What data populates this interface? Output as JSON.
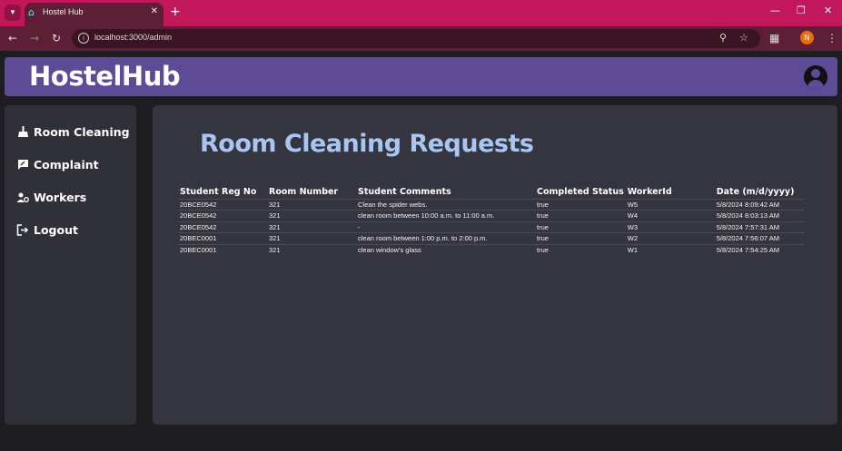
{
  "browser": {
    "tab_title": "Hostel Hub",
    "url": "localhost:3000/admin",
    "profile_initial": "N"
  },
  "header": {
    "brand": "HostelHub"
  },
  "sidebar": {
    "items": [
      {
        "label": "Room Cleaning",
        "icon": "broom-icon"
      },
      {
        "label": "Complaint",
        "icon": "complaint-icon"
      },
      {
        "label": "Workers",
        "icon": "workers-icon"
      },
      {
        "label": "Logout",
        "icon": "logout-icon"
      }
    ]
  },
  "main": {
    "title": "Room Cleaning Requests",
    "table": {
      "columns": [
        "Student Reg No",
        "Room Number",
        "Student Comments",
        "Completed Status",
        "WorkerId",
        "Date (m/d/yyyy)"
      ],
      "rows": [
        [
          "20BCE0542",
          "321",
          "Clean the spider webs.",
          "true",
          "W5",
          "5/8/2024 8:09:42 AM"
        ],
        [
          "20BCE0542",
          "321",
          "clean room between 10:00 a.m. to 11:00 a.m.",
          "true",
          "W4",
          "5/8/2024 8:03:13 AM"
        ],
        [
          "20BCE0542",
          "321",
          "-",
          "true",
          "W3",
          "5/8/2024 7:57:31 AM"
        ],
        [
          "20BEC0001",
          "321",
          "clean room between 1:00 p.m. to 2:00 p.m.",
          "true",
          "W2",
          "5/8/2024 7:56:07 AM"
        ],
        [
          "20BEC0001",
          "321",
          "clean window's glass",
          "true",
          "W1",
          "5/8/2024 7:54:25 AM"
        ]
      ]
    }
  },
  "colors": {
    "tabbar": "#c2185b",
    "header": "#5e4b96",
    "panel": "#34353e",
    "title": "#a9c6f2"
  }
}
